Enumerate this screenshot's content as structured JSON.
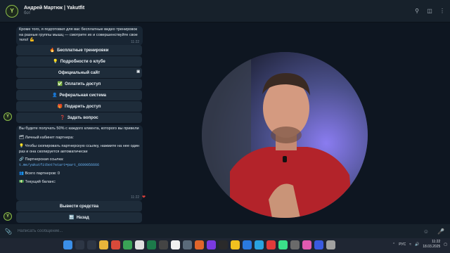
{
  "header": {
    "title": "Андрей Мартюк | Yakutfit",
    "subtitle": "бот",
    "avatar_text": "Y"
  },
  "message1": {
    "text": "Кроме того, я подготовил для вас бесплатные видео тренировок на разные группы мышц — смотрите их и совершенствуйте свое тело! 💪",
    "time": "11:22"
  },
  "buttons1": [
    {
      "icon": "🔥",
      "label": "Бесплатные тренировки"
    },
    {
      "icon": "💡",
      "label": "Подробности о клубе"
    },
    {
      "icon": "",
      "label": "Официальный сайт"
    },
    {
      "icon": "✅",
      "label": "Оплатить доступ"
    },
    {
      "icon": "👤",
      "label": "Реферальная система"
    },
    {
      "icon": "🎁",
      "label": "Подарить доступ"
    },
    {
      "icon": "❓",
      "label": "Задать вопрос"
    }
  ],
  "message2": {
    "intro": "Вы будете получать 50% с каждого клиента, которого вы привели",
    "cabinet": "🗂 Личный кабинет партнера:",
    "copy_hint": "💡 Чтобы скопировать партнерскую ссылку, нажмите на нее один раз и она скопируется автоматически",
    "link_label": "🔗 Партнерская ссылка:",
    "link": "t.me/yakutfitbot?start=part_6699056666",
    "partners": "👥 Всего партнеров: 0",
    "balance": "💵 Текущий баланс:",
    "time": "11:22"
  },
  "buttons2": [
    {
      "icon": "",
      "label": "Вывести средства"
    },
    {
      "icon": "🔙",
      "label": "Назад"
    }
  ],
  "input": {
    "placeholder": "Написать сообщение..."
  },
  "taskbar": {
    "lang": "РУС",
    "time": "11:22",
    "date": "18.03.2025"
  }
}
